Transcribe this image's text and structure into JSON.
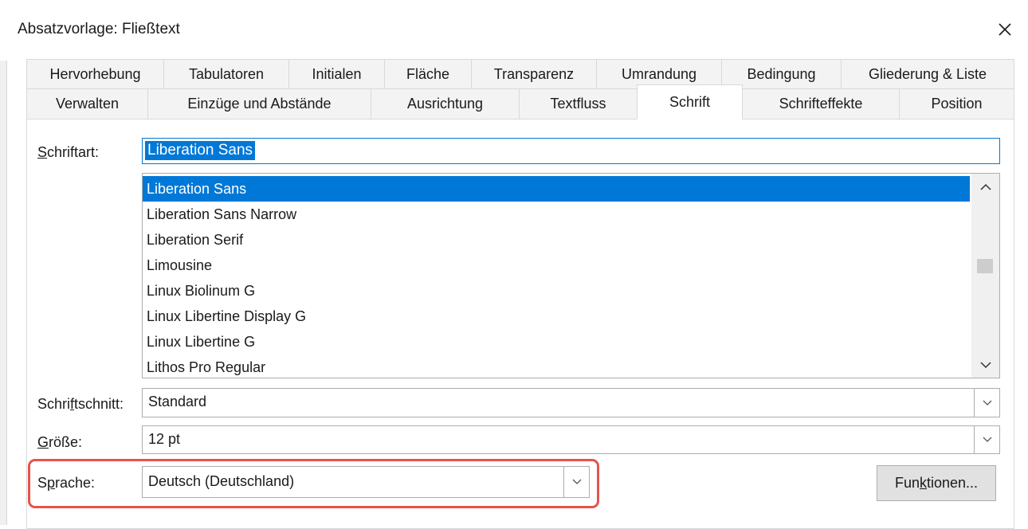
{
  "window": {
    "title": "Absatzvorlage: Fließtext",
    "close_icon": "close-icon"
  },
  "tabs_row1": [
    "Hervorhebung",
    "Tabulatoren",
    "Initialen",
    "Fläche",
    "Transparenz",
    "Umrandung",
    "Bedingung",
    "Gliederung & Liste"
  ],
  "tabs_row2": [
    "Verwalten",
    "Einzüge und Abstände",
    "Ausrichtung",
    "Textfluss",
    "Schrift",
    "Schrifteffekte",
    "Position"
  ],
  "active_tab": "Schrift",
  "font": {
    "label_pre": "",
    "label_mnemonic": "S",
    "label_post": "chriftart:",
    "value": "Liberation Sans",
    "list": [
      "Liberation Sans",
      "Liberation Sans Narrow",
      "Liberation Serif",
      "Limousine",
      "Linux Biolinum G",
      "Linux Libertine Display G",
      "Linux Libertine G",
      "Lithos Pro Regular"
    ],
    "selected_index": 0
  },
  "style": {
    "label_pre": "Schri",
    "label_mnemonic": "f",
    "label_post": "tschnitt:",
    "value": "Standard"
  },
  "size": {
    "label_pre": "",
    "label_mnemonic": "G",
    "label_post": "röße:",
    "value": "12 pt"
  },
  "language": {
    "label_pre": "S",
    "label_mnemonic": "p",
    "label_post": "rache:",
    "value": "Deutsch (Deutschland)"
  },
  "features_button": {
    "label_pre": "Fun",
    "label_mnemonic": "k",
    "label_post": "tionen..."
  },
  "colors": {
    "accent": "#0078d7",
    "highlight": "#e5534b"
  }
}
